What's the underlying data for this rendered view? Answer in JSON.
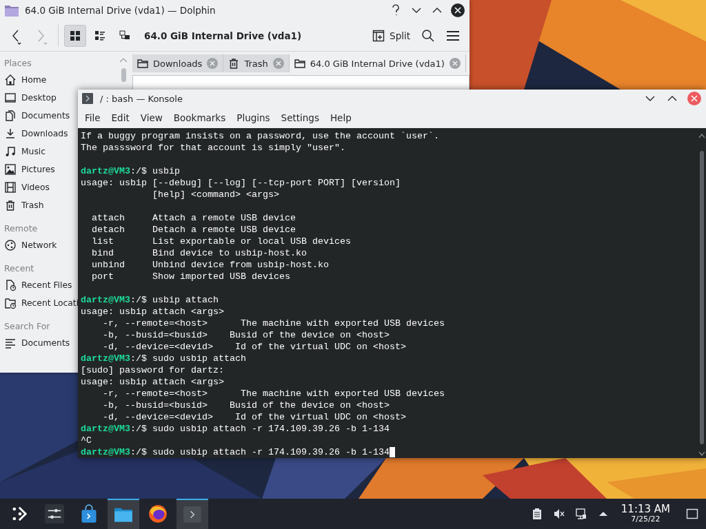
{
  "dolphin": {
    "title": "64.0 GiB Internal Drive (vda1) — Dolphin",
    "location": "64.0 GiB Internal Drive (vda1)",
    "split_label": "Split",
    "view_modes": [
      {
        "kind": "icons",
        "selected": true
      },
      {
        "kind": "compact",
        "selected": false
      },
      {
        "kind": "details",
        "selected": false
      }
    ],
    "tabs": [
      {
        "label": "Downloads",
        "kind": "folder",
        "selected": false
      },
      {
        "label": "Trash",
        "kind": "trash",
        "selected": false
      },
      {
        "label": "64.0 GiB Internal Drive (vda1)",
        "kind": "folder",
        "selected": true
      }
    ],
    "sections": [
      {
        "heading": "Places",
        "items": [
          {
            "label": "Home",
            "kind": "home"
          },
          {
            "label": "Desktop",
            "kind": "desktop"
          },
          {
            "label": "Documents",
            "kind": "documents"
          },
          {
            "label": "Downloads",
            "kind": "downloads"
          },
          {
            "label": "Music",
            "kind": "music"
          },
          {
            "label": "Pictures",
            "kind": "pictures"
          },
          {
            "label": "Videos",
            "kind": "videos"
          },
          {
            "label": "Trash",
            "kind": "trash"
          }
        ]
      },
      {
        "heading": "Remote",
        "items": [
          {
            "label": "Network",
            "kind": "network"
          }
        ]
      },
      {
        "heading": "Recent",
        "items": [
          {
            "label": "Recent Files",
            "kind": "recent"
          },
          {
            "label": "Recent Locati",
            "kind": "recent-folder"
          }
        ]
      },
      {
        "heading": "Search For",
        "items": [
          {
            "label": "Documents",
            "kind": "list"
          }
        ]
      }
    ]
  },
  "konsole": {
    "title": "/ : bash — Konsole",
    "menu": [
      "File",
      "Edit",
      "View",
      "Bookmarks",
      "Plugins",
      "Settings",
      "Help"
    ],
    "lines": [
      {
        "kind": "output",
        "text": "If a buggy program insists on a password, use the account `user`."
      },
      {
        "kind": "output",
        "text": "The passsword for that account is simply \"user\"."
      },
      {
        "kind": "blank"
      },
      {
        "kind": "prompt",
        "user": "dartz@VM3",
        "path": ":/$",
        "command": "usbip"
      },
      {
        "kind": "output",
        "text": "usage: usbip [--debug] [--log] [--tcp-port PORT] [version]"
      },
      {
        "kind": "output",
        "text": "             [help] <command> <args>"
      },
      {
        "kind": "blank"
      },
      {
        "kind": "output",
        "text": "  attach     Attach a remote USB device"
      },
      {
        "kind": "output",
        "text": "  detach     Detach a remote USB device"
      },
      {
        "kind": "output",
        "text": "  list       List exportable or local USB devices"
      },
      {
        "kind": "output",
        "text": "  bind       Bind device to usbip-host.ko"
      },
      {
        "kind": "output",
        "text": "  unbind     Unbind device from usbip-host.ko"
      },
      {
        "kind": "output",
        "text": "  port       Show imported USB devices"
      },
      {
        "kind": "blank"
      },
      {
        "kind": "prompt",
        "user": "dartz@VM3",
        "path": ":/$",
        "command": "usbip attach"
      },
      {
        "kind": "output",
        "text": "usage: usbip attach <args>"
      },
      {
        "kind": "output",
        "text": "    -r, --remote=<host>      The machine with exported USB devices"
      },
      {
        "kind": "output",
        "text": "    -b, --busid=<busid>    Busid of the device on <host>"
      },
      {
        "kind": "output",
        "text": "    -d, --device=<devid>    Id of the virtual UDC on <host>"
      },
      {
        "kind": "prompt",
        "user": "dartz@VM3",
        "path": ":/$",
        "command": "sudo usbip attach"
      },
      {
        "kind": "output",
        "text": "[sudo] password for dartz:"
      },
      {
        "kind": "output",
        "text": "usage: usbip attach <args>"
      },
      {
        "kind": "output",
        "text": "    -r, --remote=<host>      The machine with exported USB devices"
      },
      {
        "kind": "output",
        "text": "    -b, --busid=<busid>    Busid of the device on <host>"
      },
      {
        "kind": "output",
        "text": "    -d, --device=<devid>    Id of the virtual UDC on <host>"
      },
      {
        "kind": "prompt",
        "user": "dartz@VM3",
        "path": ":/$",
        "command": "sudo usbip attach -r 174.109.39.26 -b 1-134"
      },
      {
        "kind": "output",
        "text": "^C"
      },
      {
        "kind": "prompt",
        "user": "dartz@VM3",
        "path": ":/$",
        "command": "sudo usbip attach -r 174.109.39.26 -b 1-134",
        "cursor": true
      }
    ]
  },
  "taskbar": {
    "tasks": [
      {
        "kind": "launcher",
        "active": false
      },
      {
        "kind": "settings",
        "active": false
      },
      {
        "kind": "store",
        "active": false
      },
      {
        "kind": "files",
        "active": true
      },
      {
        "kind": "browser",
        "active": false
      },
      {
        "kind": "terminal",
        "active": true
      }
    ],
    "time": "11:13 AM",
    "date": "7/25/22"
  }
}
